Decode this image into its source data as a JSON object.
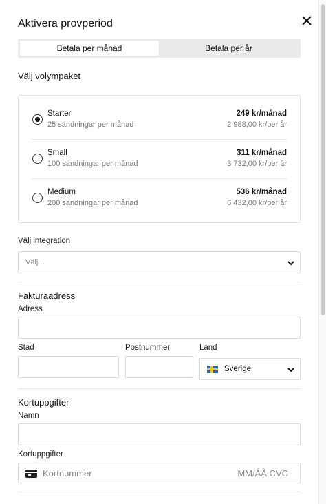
{
  "dialog": {
    "title": "Aktivera provperiod"
  },
  "billing_tabs": [
    {
      "label": "Betala per månad",
      "selected": true
    },
    {
      "label": "Betala per år",
      "selected": false
    }
  ],
  "volume": {
    "heading": "Välj volympaket",
    "plans": [
      {
        "name": "Starter",
        "description": "25 sändningar per månad",
        "price": "249 kr/månad",
        "yearly": "2 988,00 kr/per år",
        "selected": true
      },
      {
        "name": "Small",
        "description": "100 sändningar per månad",
        "price": "311 kr/månad",
        "yearly": "3 732,00 kr/per år",
        "selected": false
      },
      {
        "name": "Medium",
        "description": "200 sändningar per månad",
        "price": "536 kr/månad",
        "yearly": "6 432,00 kr/per år",
        "selected": false
      }
    ]
  },
  "integration": {
    "label": "Välj integration",
    "placeholder": "Välj..."
  },
  "billing_address": {
    "heading": "Fakturaadress",
    "address_label": "Adress",
    "city_label": "Stad",
    "postal_label": "Postnummer",
    "country_label": "Land",
    "country_value": "Sverige"
  },
  "card": {
    "heading": "Kortuppgifter",
    "name_label": "Namn",
    "card_label": "Kortuppgifter",
    "number_placeholder": "Kortnummer",
    "expiry_cvc_placeholder": "MM/ÅÅ CVC"
  },
  "icons": {
    "close": "close-icon",
    "chevron": "chevron-down-icon",
    "card": "credit-card-icon",
    "flag": "sweden-flag-icon"
  }
}
